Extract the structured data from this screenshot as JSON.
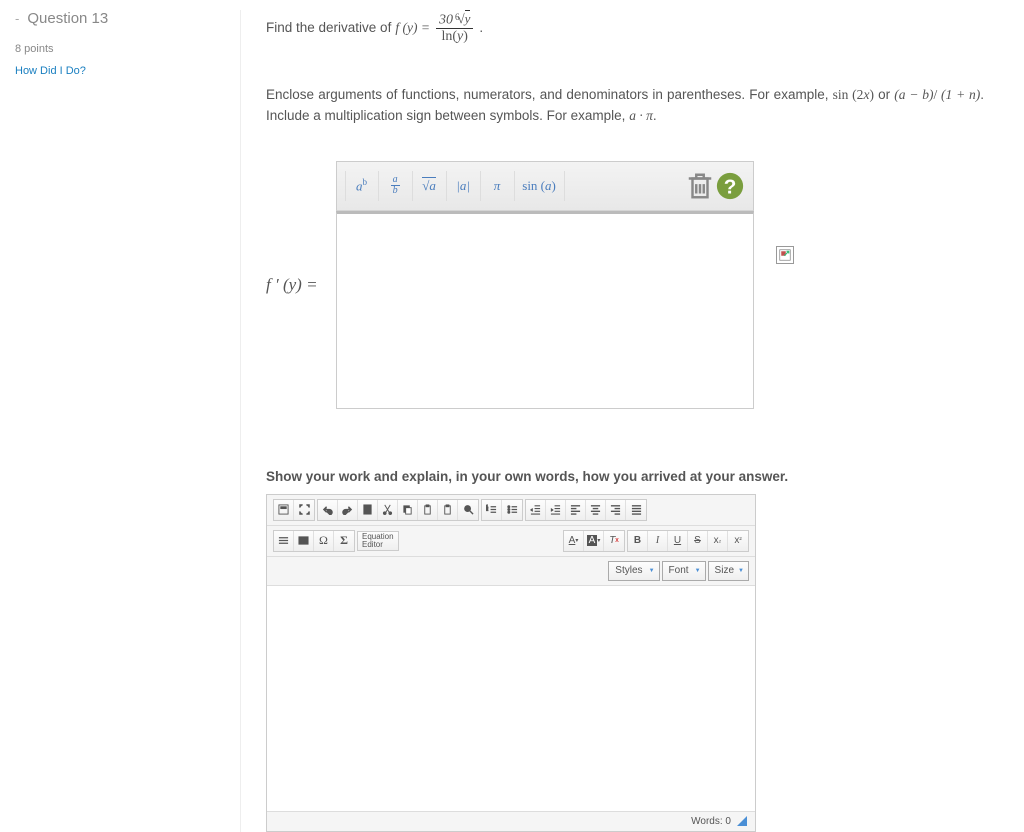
{
  "sidebar": {
    "question_label": "Question 13",
    "points": "8 points",
    "how_did_i_do": "How Did I Do?"
  },
  "question": {
    "prompt_lead": "Find the derivative of ",
    "function_lhs": "f (y) = ",
    "numerator": "30⁶√y",
    "denominator": "ln(y)",
    "period": ".",
    "instructions_1": "Enclose arguments of functions, numerators, and denominators in parentheses. For example, ",
    "instr_ex1": "sin (2x)",
    "instr_mid": " or ",
    "instr_ex2": "(a − b) / (1 + n)",
    "instructions_2": ". Include a multiplication sign between symbols. For example, ",
    "instr_ex3": "a · π",
    "period2": ".",
    "answer_lhs": "f ′ (y) ="
  },
  "eq_toolbar": {
    "btn1": "aᵇ",
    "btn2_top": "a",
    "btn2_bot": "b",
    "btn3": "√a",
    "btn4": "|a|",
    "btn5": "π",
    "btn6": "sin (a)"
  },
  "work": {
    "heading": "Show your work and explain, in your own words, how you arrived at your answer.",
    "equation_editor": "Equation\nEditor",
    "styles": "Styles",
    "font": "Font",
    "size": "Size",
    "words": "Words: 0"
  }
}
